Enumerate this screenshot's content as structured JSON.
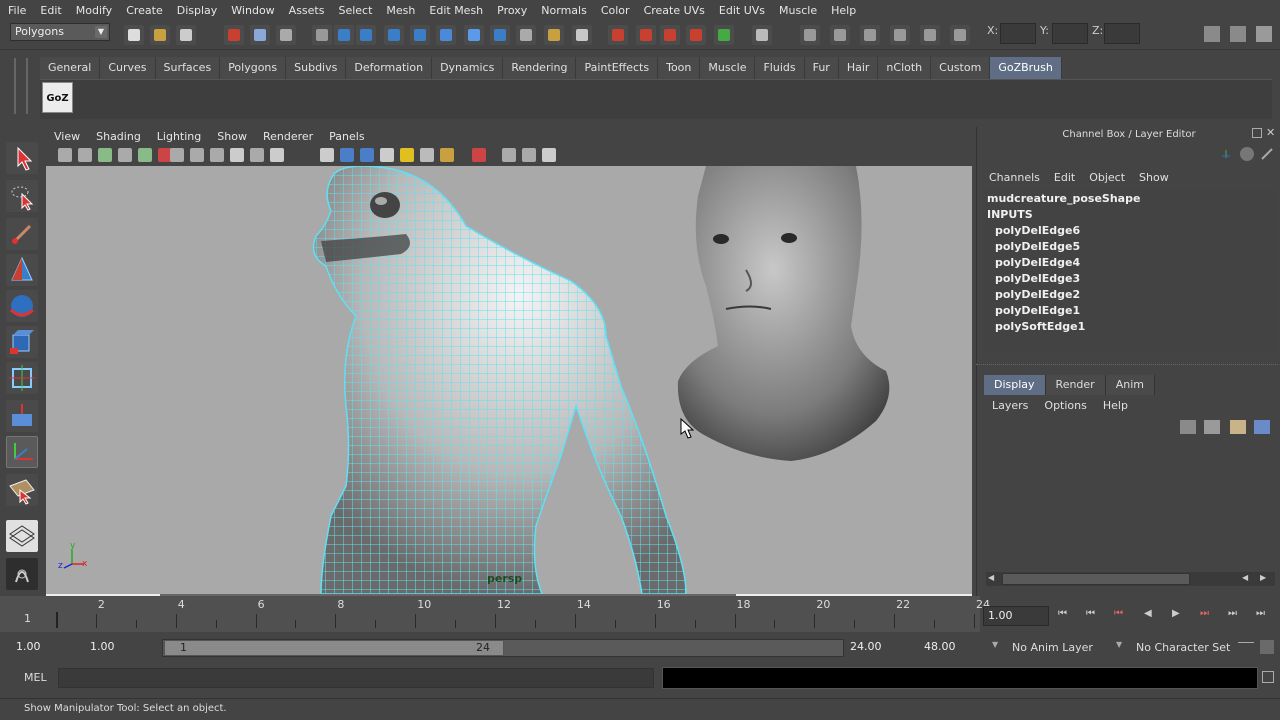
{
  "menubar": [
    "File",
    "Edit",
    "Modify",
    "Create",
    "Display",
    "Window",
    "Assets",
    "Select",
    "Mesh",
    "Edit Mesh",
    "Proxy",
    "Normals",
    "Color",
    "Create UVs",
    "Edit UVs",
    "Muscle",
    "Help"
  ],
  "status_line": {
    "mode": "Polygons",
    "x_label": "X:",
    "y_label": "Y:",
    "z_label": "Z:"
  },
  "shelf": {
    "tabs": [
      "General",
      "Curves",
      "Surfaces",
      "Polygons",
      "Subdivs",
      "Deformation",
      "Dynamics",
      "Rendering",
      "PaintEffects",
      "Toon",
      "Muscle",
      "Fluids",
      "Fur",
      "Hair",
      "nCloth",
      "Custom",
      "GoZBrush"
    ],
    "active_tab": "GoZBrush",
    "goz_label": "GoZ"
  },
  "viewport": {
    "menu": [
      "View",
      "Shading",
      "Lighting",
      "Show",
      "Renderer",
      "Panels"
    ],
    "camera_label": "persp",
    "axis": {
      "y": "y",
      "z": "z",
      "x": "x"
    }
  },
  "channel_box": {
    "title": "Channel Box / Layer Editor",
    "menu": [
      "Channels",
      "Edit",
      "Object",
      "Show"
    ],
    "object_name": "mudcreature_poseShape",
    "inputs_label": "INPUTS",
    "inputs": [
      "polyDelEdge6",
      "polyDelEdge5",
      "polyDelEdge4",
      "polyDelEdge3",
      "polyDelEdge2",
      "polyDelEdge1",
      "polySoftEdge1"
    ]
  },
  "layer_editor": {
    "tabs": [
      "Display",
      "Render",
      "Anim"
    ],
    "active_tab": "Display",
    "menu": [
      "Layers",
      "Options",
      "Help"
    ]
  },
  "timeline": {
    "ticks": [
      "2",
      "4",
      "6",
      "8",
      "10",
      "12",
      "14",
      "16",
      "18",
      "20",
      "22",
      "24"
    ],
    "start_marker": "1",
    "current_time": "1.00"
  },
  "range": {
    "start": "1.00",
    "playback_start": "1.00",
    "slider_start": "1",
    "slider_end": "24",
    "playback_end": "24.00",
    "end": "48.00",
    "anim_layer": "No Anim Layer",
    "character_set": "No Character Set"
  },
  "command_line": {
    "label": "MEL"
  },
  "help_line": "Show Manipulator Tool: Select an object.",
  "colors": {
    "accent_tab": "#5f6e84",
    "wireframe": "#5ee0f5",
    "viewport_bg": "#a9a9a9"
  }
}
